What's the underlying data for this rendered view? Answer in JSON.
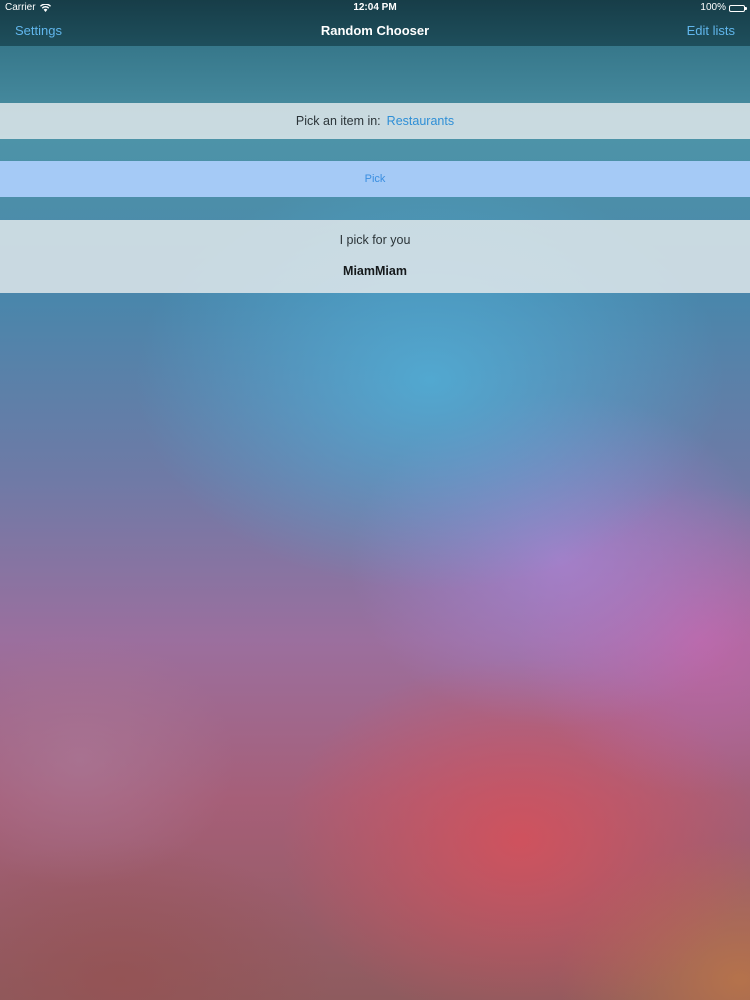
{
  "status_bar": {
    "carrier": "Carrier",
    "time": "12:04 PM",
    "battery": "100%",
    "battery_level": 1.0
  },
  "nav": {
    "left_label": "Settings",
    "title": "Random Chooser",
    "right_label": "Edit lists"
  },
  "picker": {
    "prompt": "Pick an item in:",
    "list_name": "Restaurants"
  },
  "pick_button": {
    "label": "Pick"
  },
  "result": {
    "label": "I pick for you",
    "value": "MiamMiam"
  },
  "colors": {
    "link": "#61b6ec",
    "button_text": "#3a8ee0",
    "button_bg": "#aacdfa"
  }
}
